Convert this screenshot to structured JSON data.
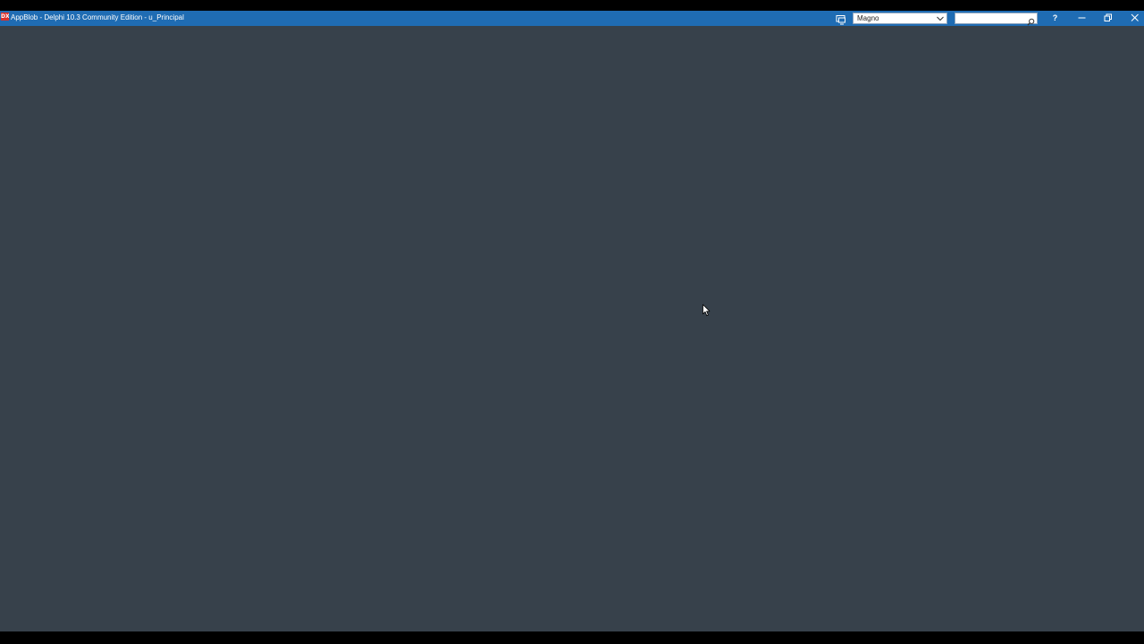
{
  "window": {
    "app_icon_text": "DX",
    "title": "AppBlob - Delphi 10.3 Community Edition - u_Principal"
  },
  "toolbar": {
    "layout_icon": "desktop-layout-icon",
    "layout_selected": "Magno",
    "search_value": "",
    "search_icon": "search-icon",
    "help_label": "?"
  },
  "controls": {
    "minimize_icon": "minimize-icon",
    "restore_icon": "restore-icon",
    "close_icon": "close-icon"
  },
  "colors": {
    "titlebar": "#1f6cb3",
    "client_area": "#37414b",
    "frame": "#000000"
  }
}
